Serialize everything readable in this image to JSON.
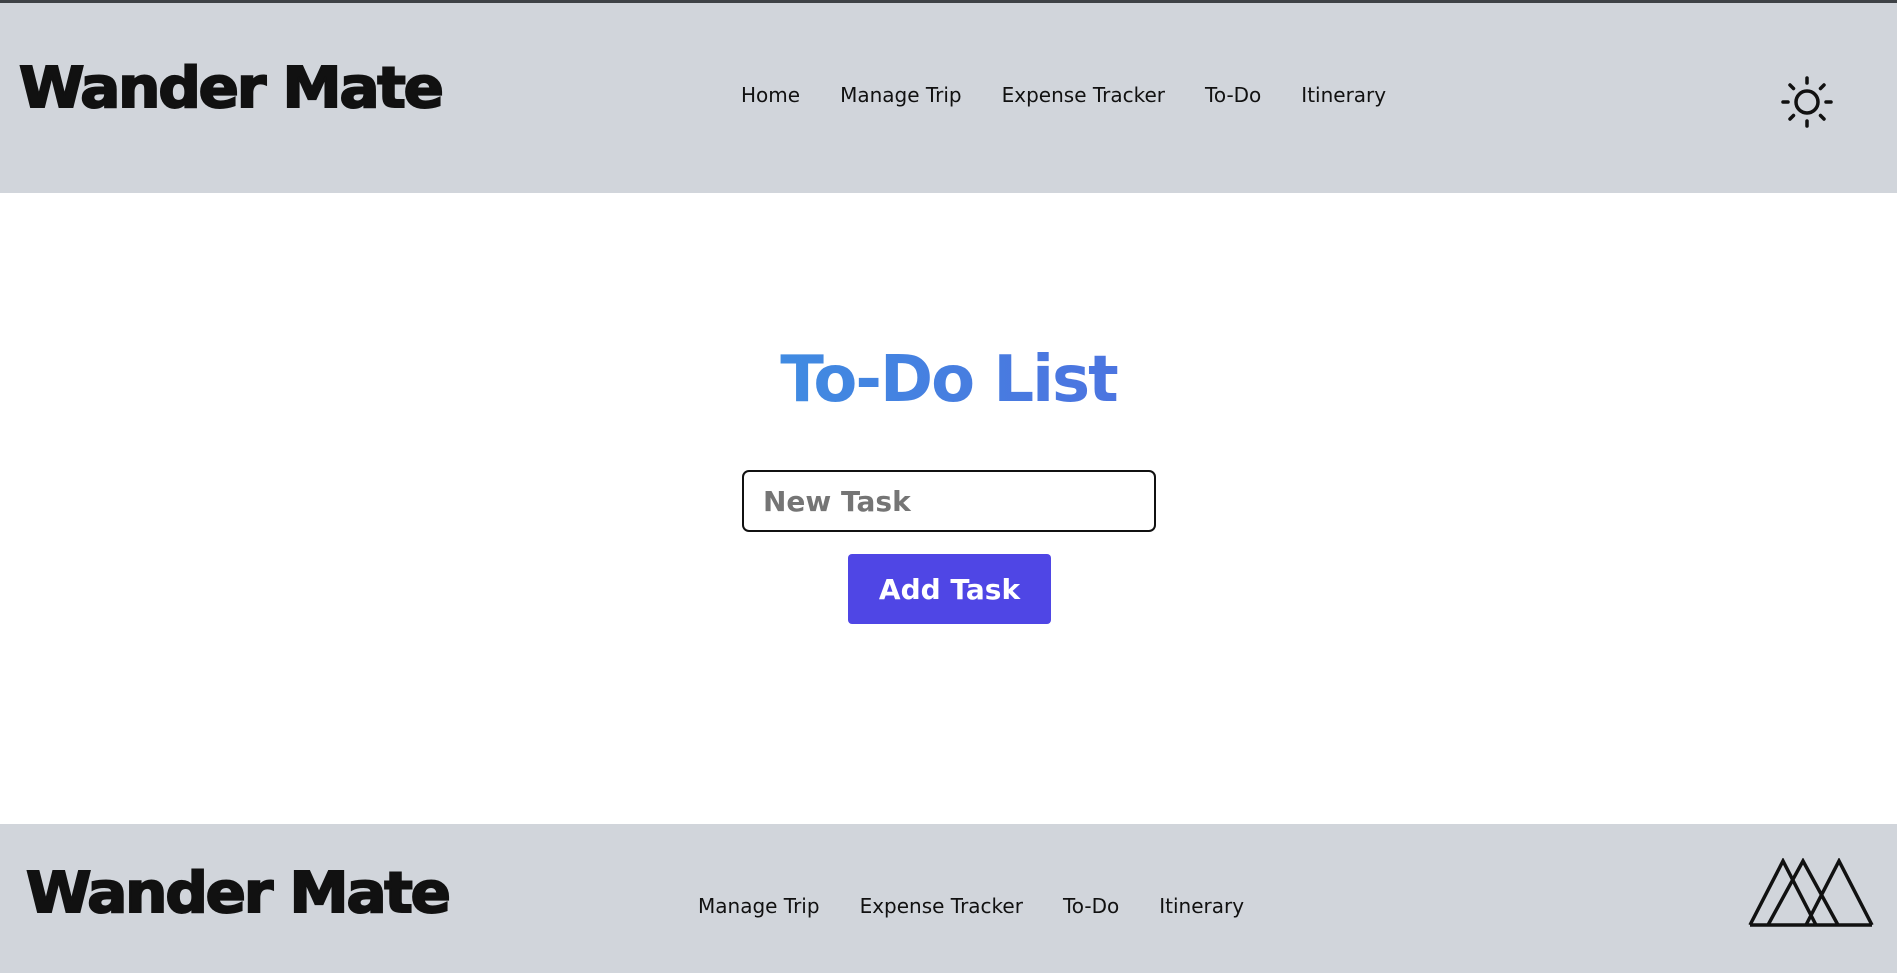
{
  "header": {
    "brand": "Wander Mate",
    "nav": [
      {
        "label": "Home"
      },
      {
        "label": "Manage Trip"
      },
      {
        "label": "Expense Tracker"
      },
      {
        "label": "To-Do"
      },
      {
        "label": "Itinerary"
      }
    ],
    "theme_toggle_icon": "sun-icon"
  },
  "main": {
    "title": "To-Do List",
    "task_input": {
      "placeholder": "New Task",
      "value": ""
    },
    "add_button_label": "Add Task"
  },
  "footer": {
    "brand": "Wander Mate",
    "nav": [
      {
        "label": "Manage Trip"
      },
      {
        "label": "Expense Tracker"
      },
      {
        "label": "To-Do"
      },
      {
        "label": "Itinerary"
      }
    ],
    "logo_icon": "mountains-icon"
  },
  "colors": {
    "header_bg": "#d1d5db",
    "footer_bg": "#d1d5db",
    "button_bg": "#4f46e5",
    "title_gradient_start": "#22c3e6",
    "title_gradient_end": "#5b52e0"
  }
}
